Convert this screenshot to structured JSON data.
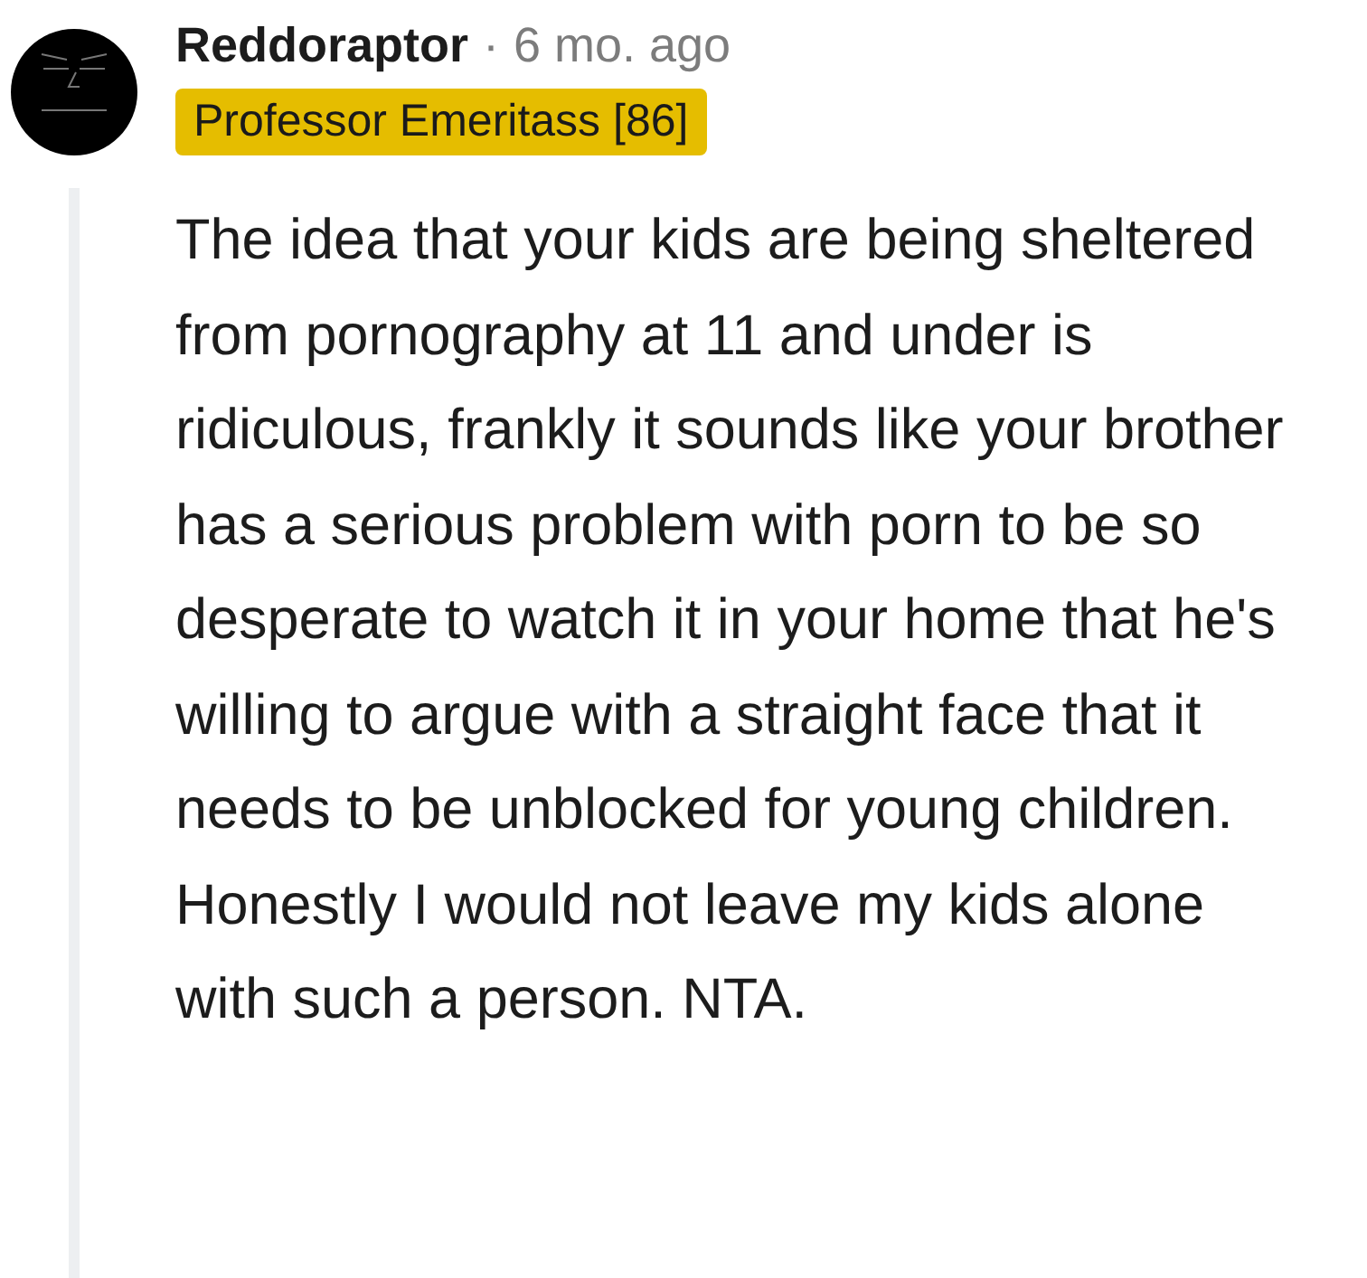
{
  "comment": {
    "author": "Reddoraptor",
    "separator": "·",
    "time": "6 mo. ago",
    "flair": "Professor Emeritass [86]",
    "body": "The idea that your kids are being sheltered from pornography at 11 and under is ridiculous, frankly it sounds like your brother has a serious problem with porn to be so desperate to watch it in your home that he's willing to argue with a straight face that it needs to be unblocked for young children. Honestly I would not leave my kids alone with such a person. NTA."
  }
}
